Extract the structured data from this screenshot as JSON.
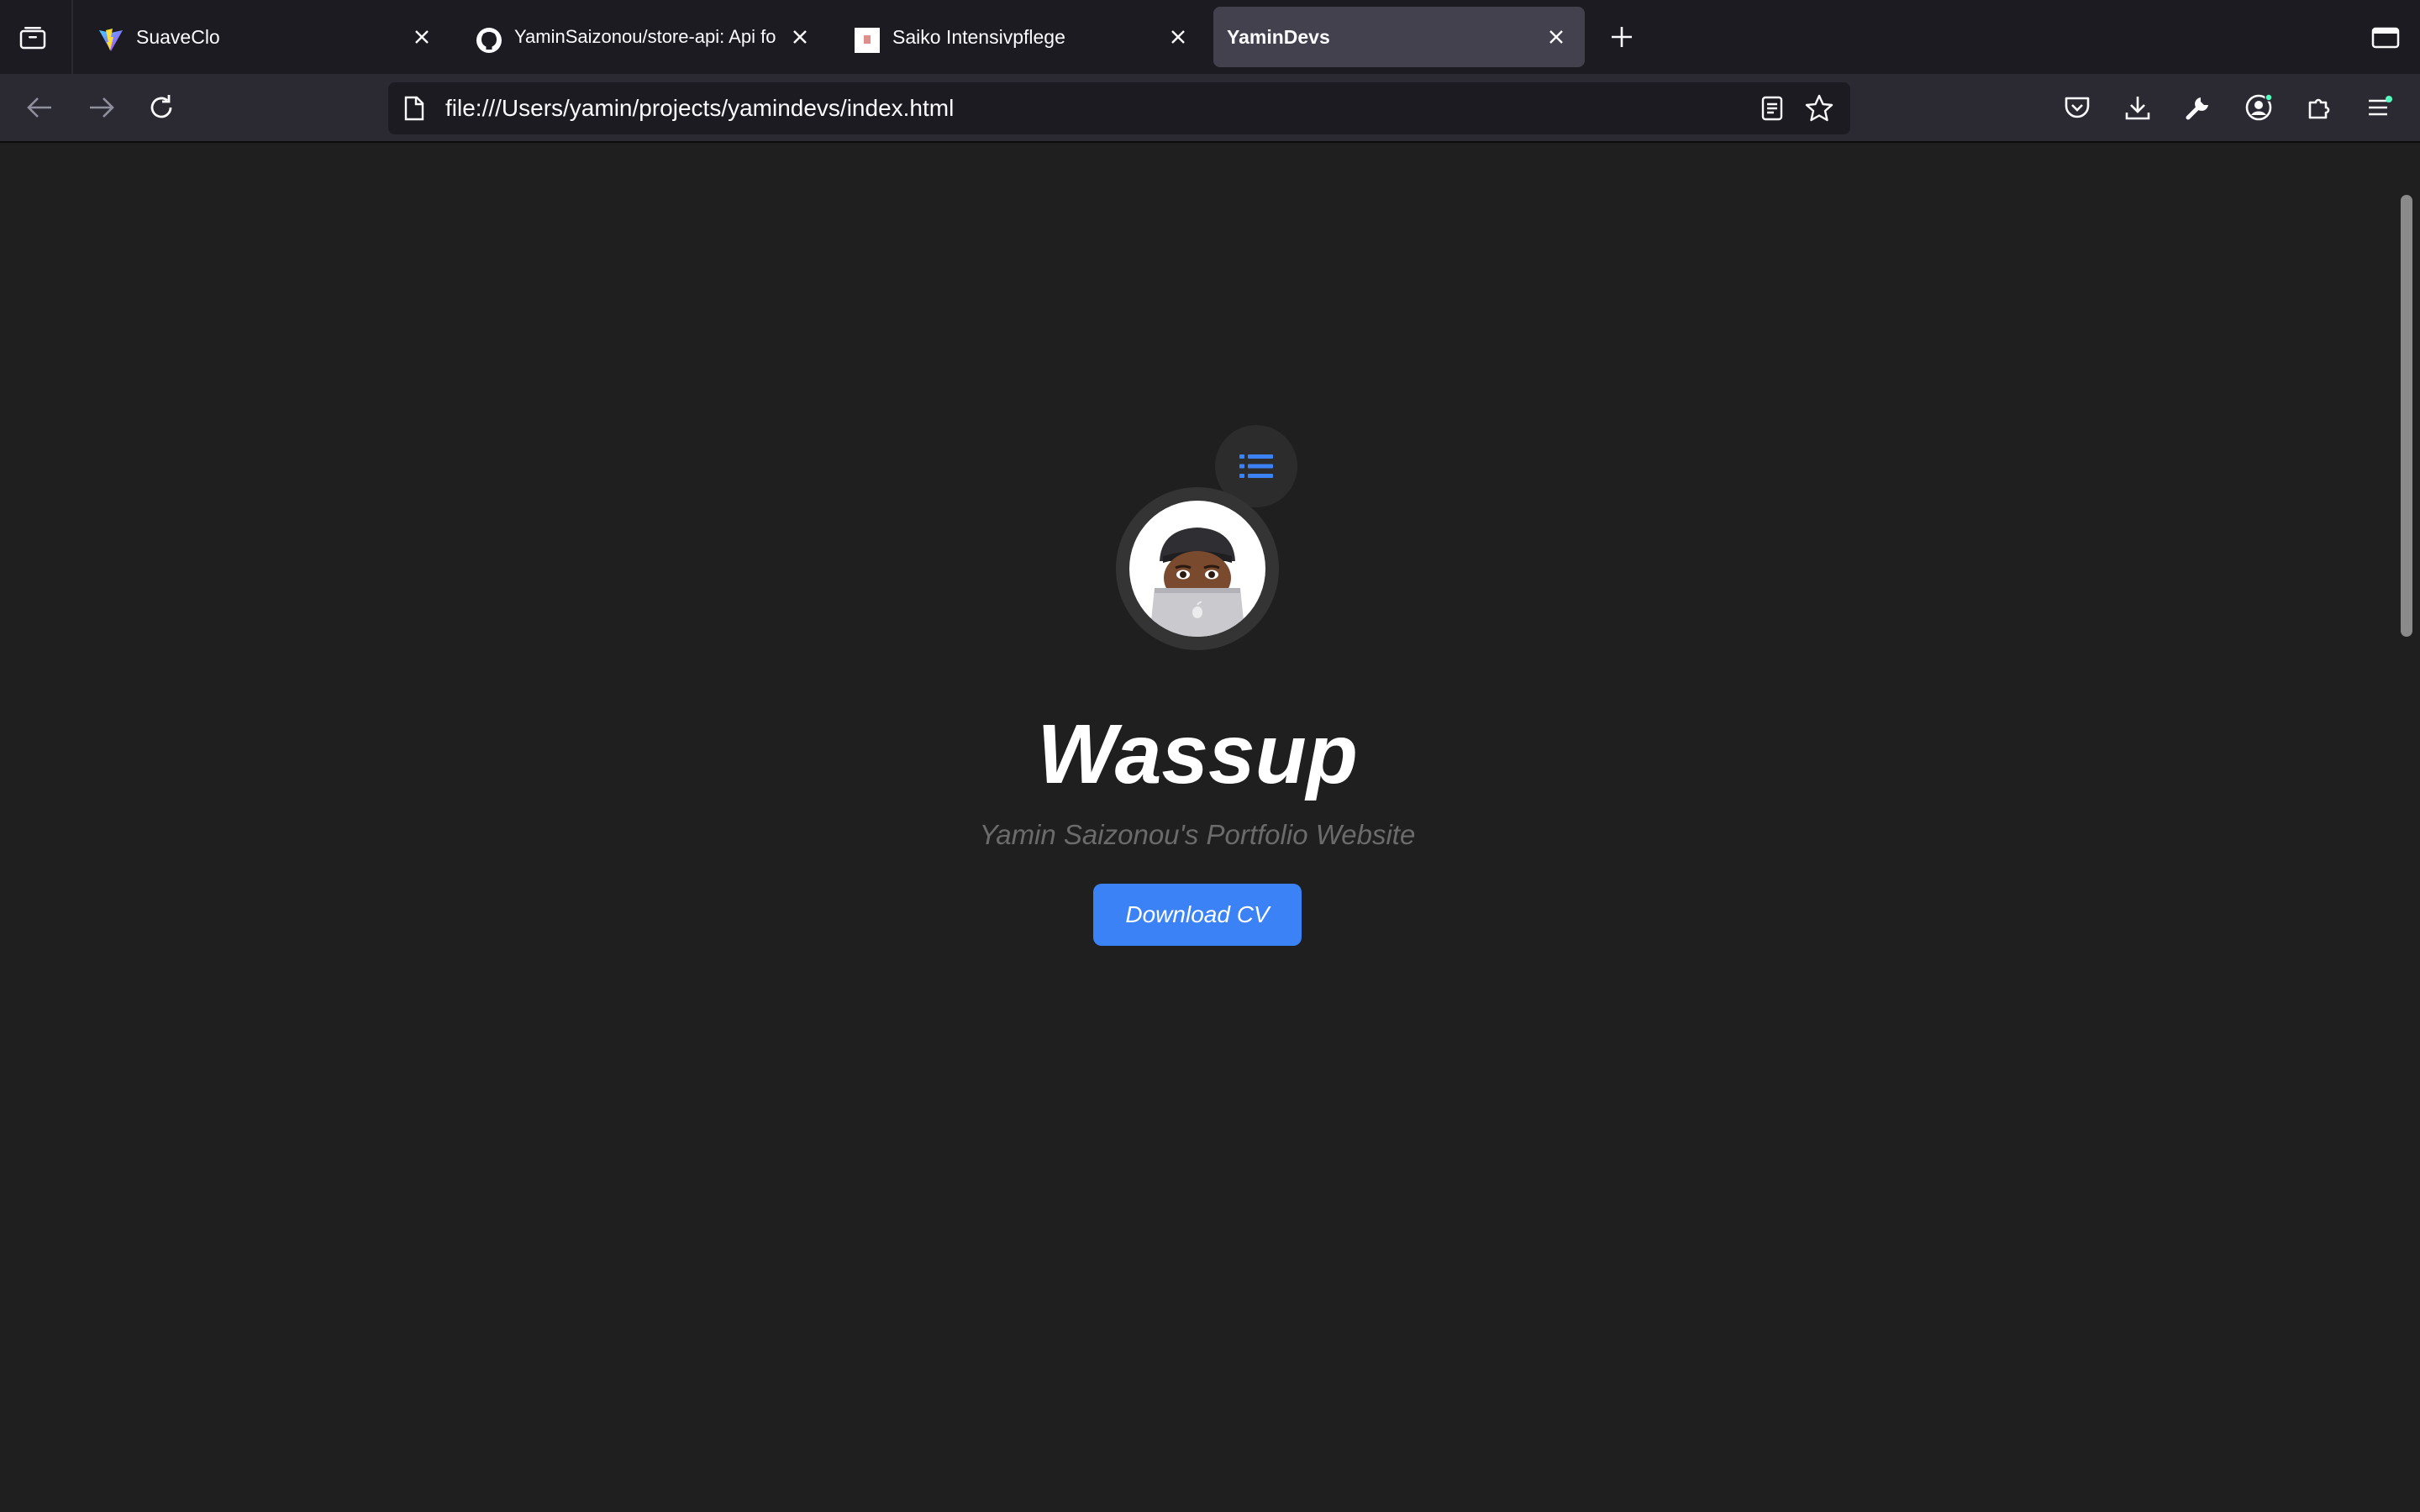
{
  "browser": {
    "tabs": [
      {
        "title": "SuaveClo",
        "icon": "vite-logo-icon",
        "selected": false
      },
      {
        "title": "YaminSaizonou/store-api: Api fo",
        "icon": "github-icon",
        "selected": false
      },
      {
        "title": "Saiko Intensivpflege",
        "icon": "site-favicon-icon",
        "selected": false
      },
      {
        "title": "YaminDevs",
        "icon": "",
        "selected": true
      }
    ],
    "url": "file:///Users/yamin/projects/yamindevs/index.html"
  },
  "page": {
    "title": "Wassup",
    "subtitle": "Yamin Saizonou's Portfolio Website",
    "cta_label": "Download CV"
  },
  "colors": {
    "accent": "#3b82f6",
    "page_background": "#1f1f1f",
    "toolbar": "#2b2a33",
    "tabstrip": "#1c1b22"
  }
}
